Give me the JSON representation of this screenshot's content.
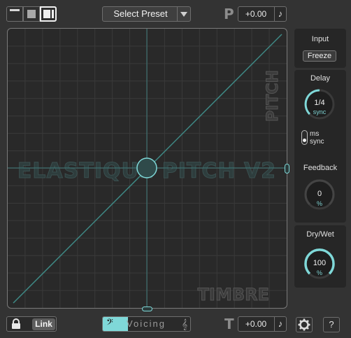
{
  "toolbar": {
    "view_buttons": [
      "compact-view",
      "medium-view",
      "full-view"
    ],
    "preset_label": "Select Preset",
    "pitch_axis_letter": "P",
    "pitch_value": "+0.00",
    "note_glyph": "♪"
  },
  "pad": {
    "watermark": "ELASTIQUE PITCH V2",
    "pitch_label": "PITCH",
    "timbre_label": "TIMBRE",
    "accent_color": "#7fd8d8"
  },
  "sidebar": {
    "input": {
      "title": "Input",
      "freeze_label": "Freeze"
    },
    "delay": {
      "title": "Delay",
      "knob_value": "1/4",
      "knob_unit": "sync",
      "mode_ms": "ms",
      "mode_sync": "sync"
    },
    "feedback": {
      "title": "Feedback",
      "knob_value": "0",
      "knob_unit": "%"
    },
    "drywet": {
      "title": "Dry/Wet",
      "knob_value": "100",
      "knob_unit": "%"
    }
  },
  "bottom": {
    "link_label": "Link",
    "voicing_label": "Voicing",
    "bass_clef": "𝄢",
    "treble_clef": "𝄞",
    "timbre_axis_letter": "T",
    "timbre_value": "+0.00",
    "note_glyph": "♪",
    "help_label": "?"
  }
}
